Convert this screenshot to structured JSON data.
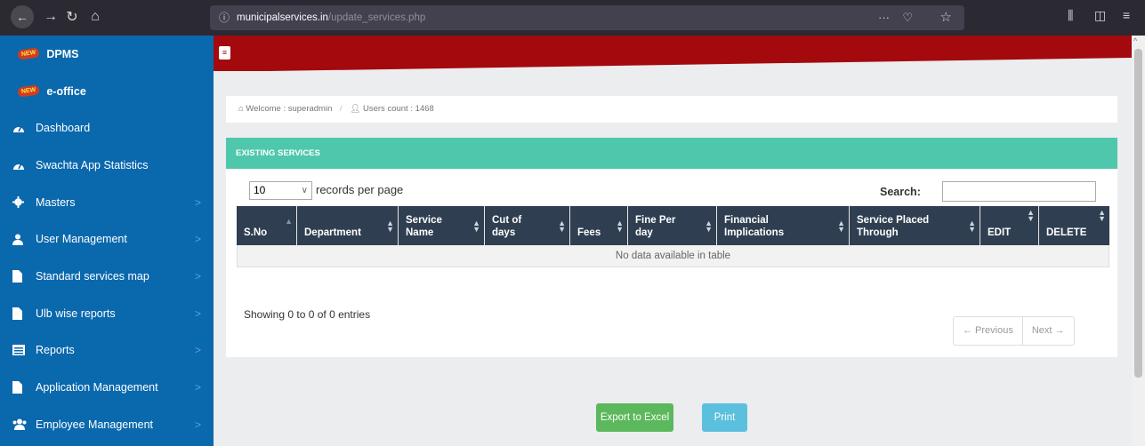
{
  "browser": {
    "url_domain": "municipalservices.in",
    "url_path": "/update_services.php",
    "icons": [
      "back-arrow-icon",
      "forward-arrow-icon",
      "reload-icon",
      "home-icon",
      "info-icon",
      "more-icon",
      "pocket-icon",
      "bookmark-star-icon",
      "library-icon",
      "sidebar-icon",
      "hamburger-menu-icon"
    ]
  },
  "sidebar": {
    "items": [
      {
        "label": "DPMS",
        "badge": "NEW",
        "icon": "new-badge-icon"
      },
      {
        "label": "e-office",
        "badge": "NEW",
        "icon": "new-badge-icon"
      },
      {
        "label": "Dashboard",
        "icon": "tachometer-icon"
      },
      {
        "label": "Swachta App Statistics",
        "icon": "tachometer-icon"
      },
      {
        "label": "Masters",
        "icon": "gear-icon",
        "chevron": ">"
      },
      {
        "label": "User Management",
        "icon": "user-icon",
        "chevron": ">"
      },
      {
        "label": "Standard services map",
        "icon": "file-icon",
        "chevron": ">"
      },
      {
        "label": "Ulb wise reports",
        "icon": "file-icon",
        "chevron": ">"
      },
      {
        "label": "Reports",
        "icon": "table-icon",
        "chevron": ">"
      },
      {
        "label": "Application Management",
        "icon": "file-icon",
        "chevron": ">"
      },
      {
        "label": "Employee Management",
        "icon": "users-icon",
        "chevron": ">"
      }
    ],
    "color": "#0a68ad"
  },
  "breadcrumb": {
    "welcome": "Welcome : superadmin",
    "users_count": "Users count : 1468"
  },
  "panel": {
    "title": "EXISTING SERVICES",
    "header_color": "#4fc7ad"
  },
  "table_controls": {
    "page_length": "10",
    "length_label": "records per page",
    "search_label": "Search:",
    "search_value": ""
  },
  "table": {
    "columns": [
      "S.No",
      "Department",
      "Service Name",
      "Cut of days",
      "Fees",
      "Fine Per day",
      "Financial Implications",
      "Service Placed Through",
      "EDIT",
      "DELETE"
    ],
    "empty_message": "No data available in table"
  },
  "footer": {
    "info": "Showing 0 to 0 of 0 entries",
    "previous": "← Previous",
    "next": "Next →"
  },
  "actions": {
    "export_excel": "Export to Excel",
    "print": "Print"
  }
}
